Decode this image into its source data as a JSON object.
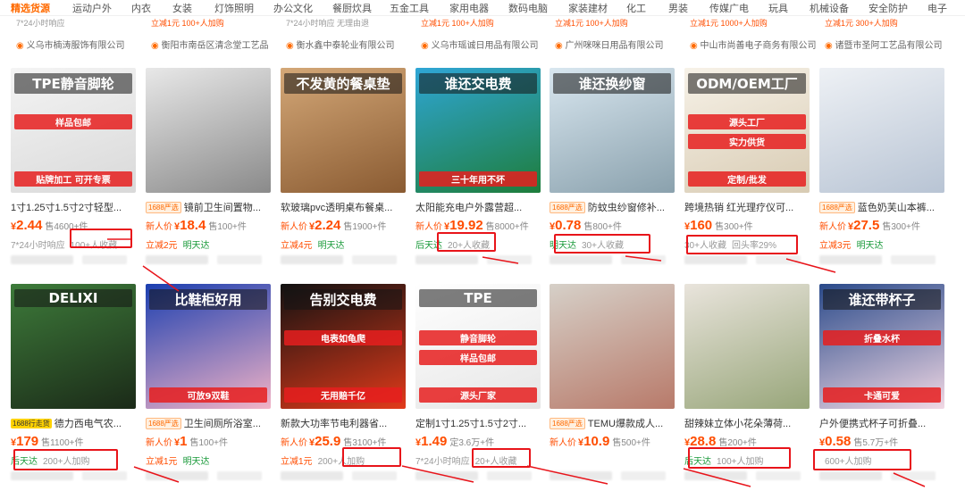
{
  "nav": [
    "精选货源",
    "运动户外",
    "内衣",
    "女装",
    "灯饰照明",
    "办公文化",
    "餐厨炊具",
    "五金工具",
    "家用电器",
    "数码电脑",
    "家装建材",
    "化工",
    "男装",
    "传媒广电",
    "玩具",
    "机械设备",
    "安全防护",
    "电子"
  ],
  "prev_row": [
    {
      "meta": "7*24小时响应",
      "hl": "",
      "shop": "义乌市楠涛服饰有限公司"
    },
    {
      "meta": "立减1元  100+人加购",
      "hl": "立减1元",
      "shop": "衡阳市南岳区清念堂工艺品"
    },
    {
      "meta": "7*24小时响应  无理由退",
      "hl": "",
      "shop": "衡水鑫中泰轮业有限公司"
    },
    {
      "meta": "立减1元  100+人加购",
      "hl": "立减1元",
      "shop": "义乌市瑶诚日用品有限公司"
    },
    {
      "meta": "立减1元  100+人加购",
      "hl": "立减1元",
      "shop": "广州咪咪日用品有限公司"
    },
    {
      "meta": "立减1元  1000+人加购",
      "hl": "立减1元",
      "shop": "中山市尚善电子商务有限公司"
    },
    {
      "meta": "立减1元  300+人加购",
      "hl": "立减1元",
      "shop": "诸暨市圣阿工艺品有限公司"
    }
  ],
  "products": [
    {
      "tag": "",
      "title": "1寸1.25寸1.5寸2寸轻型...",
      "new": "",
      "price": "2.44",
      "sold": "售4600+件",
      "l3a": "7*24小时响应",
      "l3b": "100+人收藏",
      "l3a_style": "gray",
      "img_text": [
        "TPE静音脚轮",
        "样品包邮",
        "贴牌加工 可开专票"
      ]
    },
    {
      "tag": "1688严选",
      "title": "镜前卫生间置物...",
      "new": "新人价",
      "price": "18.4",
      "sold": "售100+件",
      "l3a": "立减2元",
      "l3b": "明天达",
      "l3a_style": "orange",
      "img_text": []
    },
    {
      "tag": "",
      "title": "软玻璃pvc透明桌布餐桌...",
      "new": "新人价",
      "price": "2.24",
      "sold": "售1900+件",
      "l3a": "立减4元",
      "l3b": "明天达",
      "l3a_style": "orange",
      "img_text": [
        "不发黄的餐桌垫"
      ]
    },
    {
      "tag": "",
      "title": "太阳能充电户外露营超...",
      "new": "新人价",
      "price": "19.92",
      "sold": "售8000+件",
      "l3a": "后天达",
      "l3b": "20+人收藏",
      "l3a_style": "green",
      "img_text": [
        "谁还交电费",
        "三十年用不坏"
      ]
    },
    {
      "tag": "1688严选",
      "title": "防蚊虫纱窗修补...",
      "new": "",
      "price": "0.78",
      "sold": "售800+件",
      "l3a": "明天达",
      "l3b": "30+人收藏",
      "l3a_style": "green",
      "img_text": [
        "谁还换纱窗"
      ]
    },
    {
      "tag": "",
      "title": "跨境热销 红光理疗仪可...",
      "new": "",
      "price": "160",
      "sold": "售300+件",
      "l3a": "30+人收藏",
      "l3b": "回头率29%",
      "l3a_style": "gray",
      "img_text": [
        "ODM/OEM工厂",
        "源头工厂",
        "实力供货",
        "定制/批发"
      ]
    },
    {
      "tag": "1688严选",
      "title": "蓝色奶芙山本裤...",
      "new": "新人价",
      "price": "27.5",
      "sold": "售300+件",
      "l3a": "立减3元",
      "l3b": "明天达",
      "l3a_style": "orange",
      "img_text": []
    },
    {
      "tag": "1688行走货",
      "title": "德力西电气农...",
      "new": "",
      "price": "179",
      "sold": "售1100+件",
      "l3a": "后天达",
      "l3b": "200+人加购",
      "l3a_style": "green",
      "img_text": [
        "DELIXI"
      ]
    },
    {
      "tag": "1688严选",
      "title": "卫生间厕所浴室...",
      "new": "新人价",
      "price": "1",
      "sold": "售100+件",
      "l3a": "立减1元",
      "l3b": "明天达",
      "l3a_style": "orange",
      "img_text": [
        "比鞋柜好用",
        "可放9双鞋"
      ]
    },
    {
      "tag": "",
      "title": "新款大功率节电利器省...",
      "new": "新人价",
      "price": "25.9",
      "sold": "售3100+件",
      "l3a": "立减1元",
      "l3b": "200+人加购",
      "l3a_style": "orange",
      "img_text": [
        "告别交电费",
        "电表如龟爬",
        "无用赔千亿"
      ]
    },
    {
      "tag": "",
      "title": "定制1寸1.25寸1.5寸2寸...",
      "new": "",
      "price": "1.49",
      "sold": "定3.6万+件",
      "l3a": "7*24小时响应",
      "l3b": "20+人收藏",
      "l3a_style": "gray",
      "img_text": [
        "TPE",
        "静音脚轮",
        "样品包邮",
        "源头厂家"
      ]
    },
    {
      "tag": "1688严选",
      "title": "TEMU爆款成人...",
      "new": "新人价",
      "price": "10.9",
      "sold": "售500+件",
      "l3a": "",
      "l3b": "",
      "l3a_style": "gray",
      "img_text": []
    },
    {
      "tag": "",
      "title": "甜辣妹立体小花朵薄荷...",
      "new": "",
      "price": "28.8",
      "sold": "售200+件",
      "l3a": "后天达",
      "l3b": "100+人加购",
      "l3a_style": "green",
      "img_text": []
    },
    {
      "tag": "",
      "title": "户外便携式杯子可折叠...",
      "new": "",
      "price": "0.58",
      "sold": "售5.7万+件",
      "l3a": "",
      "l3b": "600+人加购",
      "l3a_style": "gray",
      "img_text": [
        "谁还带杯子",
        "折叠水杯",
        "卡通可爱"
      ]
    }
  ]
}
